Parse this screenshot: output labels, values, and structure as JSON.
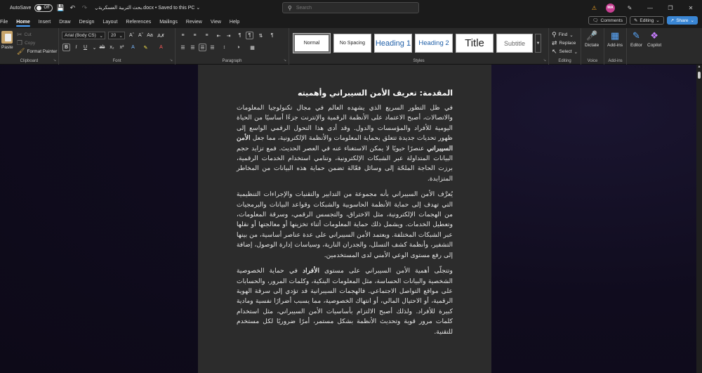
{
  "titlebar": {
    "autosave_label": "AutoSave",
    "autosave_state": "Off",
    "doc_title": "بحث التربية العسكرية.docx • Saved to this PC ⌄",
    "search_placeholder": "Search",
    "avatar_initials": "MA"
  },
  "menu": {
    "tabs": [
      "File",
      "Home",
      "Insert",
      "Draw",
      "Design",
      "Layout",
      "References",
      "Mailings",
      "Review",
      "View",
      "Help"
    ],
    "active_tab": "Home",
    "comments_label": "Comments",
    "editing_label": "Editing",
    "share_label": "Share"
  },
  "ribbon": {
    "clipboard": {
      "label": "Clipboard",
      "paste": "Paste",
      "cut": "Cut",
      "copy": "Copy",
      "format_painter": "Format Painter"
    },
    "font": {
      "label": "Font",
      "font_name": "Arial (Body CS)",
      "font_size": "20"
    },
    "paragraph": {
      "label": "Paragraph"
    },
    "styles": {
      "label": "Styles",
      "items": [
        "Normal",
        "No Spacing",
        "Heading 1",
        "Heading 2",
        "Title",
        "Subtitle"
      ]
    },
    "editing": {
      "label": "Editing",
      "find": "Find",
      "replace": "Replace",
      "select": "Select"
    },
    "voice": {
      "label": "Voice",
      "dictate": "Dictate"
    },
    "addins": {
      "label": "Add-ins",
      "addins_btn": "Add-ins"
    },
    "editor": "Editor",
    "copilot": "Copilot"
  },
  "document": {
    "heading": "المقدمة: تعريف الأمن السيبراني وأهميته",
    "p1_a": "في ظل التطور السريع الذي يشهده العالم في مجال تكنولوجيا المعلومات والاتصالات، أصبح الاعتماد على الأنظمة الرقمية والإنترنت جزءًا أساسيًا من الحياة اليومية للأفراد والمؤسسات والدول. وقد أدى هذا التحول الرقمي الواسع إلى ظهور تحديات جديدة تتعلق بحماية المعلومات والأنظمة الإلكترونية، مما جعل ",
    "p1_bold": "الأمن السيبراني",
    "p1_b": " عنصرًا حيويًا لا يمكن الاستغناء عنه في العصر الحديث. فمع تزايد حجم البيانات المتداولة عبر الشبكات الإلكترونية، وتنامي استخدام الخدمات الرقمية، برزت الحاجة الملحّة إلى وسائل فعّالة تضمن حماية هذه البيانات من المخاطر المتزايدة.",
    "p2": "يُعرَّف الأمن السيبراني بأنه مجموعة من التدابير والتقنيات والإجراءات التنظيمية التي تهدف إلى حماية الأنظمة الحاسوبية والشبكات وقواعد البيانات والبرمجيات من الهجمات الإلكترونية، مثل الاختراق، والتجسس الرقمي، وسرقة المعلومات، وتعطيل الخدمات. ويشمل ذلك حماية المعلومات أثناء تخزينها أو معالجتها أو نقلها عبر الشبكات المختلفة. ويعتمد الأمن السيبراني على عدة عناصر أساسية، من بينها التشفير، وأنظمة كشف التسلل، والجدران النارية، وسياسات إدارة الوصول، إضافة إلى رفع مستوى الوعي الأمني لدى المستخدمين.",
    "p3_a": "وتتجلّى أهمية الأمن السيبراني على مستوى ",
    "p3_bold": "الأفراد",
    "p3_b": " في حماية الخصوصية الشخصية والبيانات الحساسة، مثل المعلومات البنكية، وكلمات المرور، والحسابات على مواقع التواصل الاجتماعي. فالهجمات السيبرانية قد تؤدي إلى سرقة الهوية الرقمية، أو الاحتيال المالي، أو انتهاك الخصوصية، مما يسبب أضرارًا نفسية ومادية كبيرة للأفراد. ولذلك أصبح الالتزام بأساسيات الأمن السيبراني، مثل استخدام كلمات مرور قوية وتحديث الأنظمة بشكل مستمر، أمرًا ضروريًا لكل مستخدم للتقنية."
  }
}
